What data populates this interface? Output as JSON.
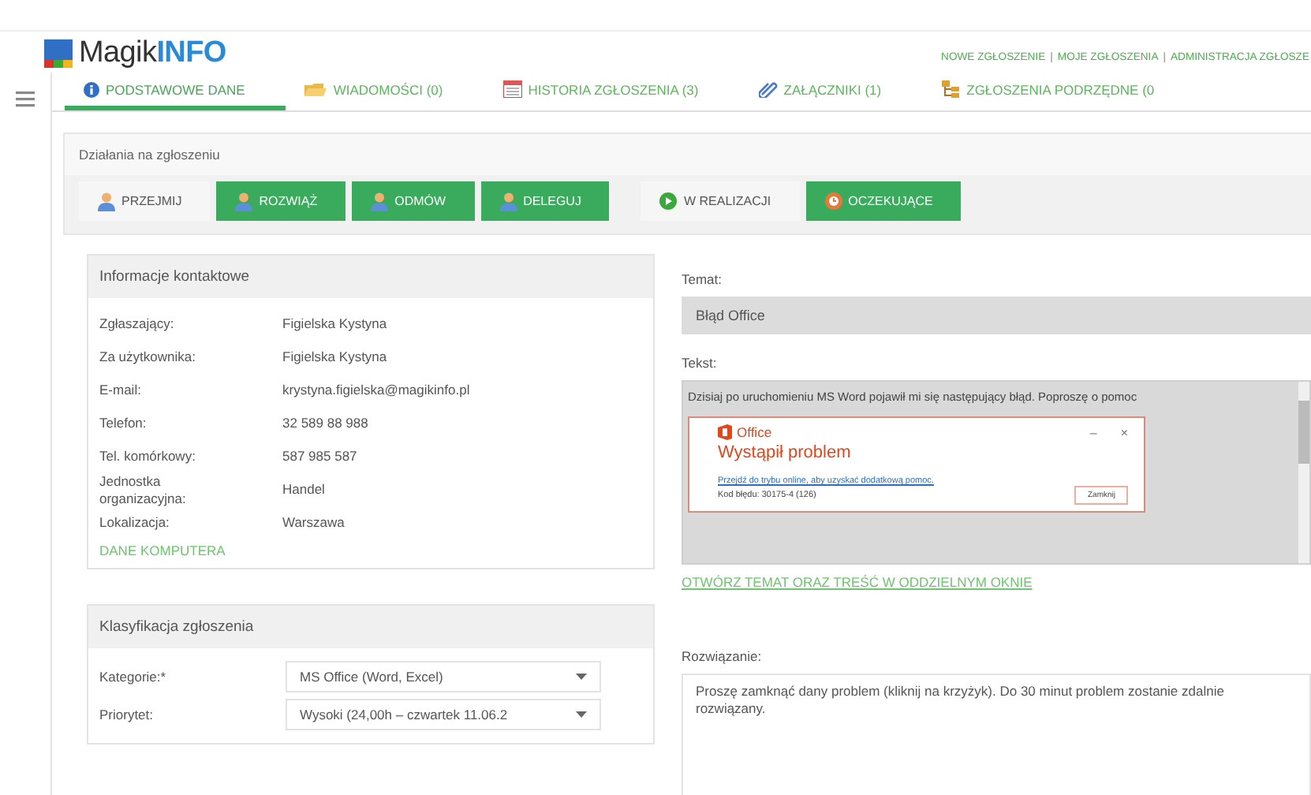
{
  "logo": {
    "brand": "Magik",
    "accent": "INFO"
  },
  "top_links": [
    "NOWE ZGŁOSZENIE",
    "MOJE ZGŁOSZENIA",
    "ADMINISTRACJA ZGŁOSZE"
  ],
  "link_separator": "|",
  "tabs": [
    {
      "label": "PODSTAWOWE DANE",
      "selected": true
    },
    {
      "label": "WIADOMOŚCI (0)",
      "selected": false
    },
    {
      "label": "HISTORIA ZGŁOSZENIA (3)",
      "selected": false
    },
    {
      "label": "ZAŁĄCZNIKI (1)",
      "selected": false
    },
    {
      "label": "ZGŁOSZENIA PODRZĘDNE (0",
      "selected": false
    }
  ],
  "actions": {
    "title": "Działania na zgłoszeniu",
    "ticket_buttons": [
      {
        "label": "PRZEJMIJ",
        "highlighted": false
      },
      {
        "label": "ROZWIĄŻ",
        "highlighted": true
      },
      {
        "label": "ODMÓW",
        "highlighted": true
      },
      {
        "label": "DELEGUJ",
        "highlighted": true
      }
    ],
    "status_buttons": [
      {
        "label": "W REALIZACJI",
        "highlighted": false
      },
      {
        "label": "OCZEKUJĄCE",
        "highlighted": true
      }
    ]
  },
  "contact": {
    "title": "Informacje kontaktowe",
    "fields": [
      {
        "label": "Zgłaszający:",
        "value": "Figielska Kystyna"
      },
      {
        "label": "Za użytkownika:",
        "value": "Figielska Kystyna"
      },
      {
        "label": "E-mail:",
        "value": "krystyna.figielska@magikinfo.pl"
      },
      {
        "label": "Telefon:",
        "value": "32 589 88 988"
      },
      {
        "label": "Tel. komórkowy:",
        "value": "587 985 587"
      },
      {
        "label": "Jednostka organizacyjna:",
        "value": "Handel"
      },
      {
        "label": "Lokalizacja:",
        "value": "Warszawa"
      }
    ],
    "link": "DANE KOMPUTERA"
  },
  "subject": {
    "label": "Temat:",
    "value": "Błąd Office"
  },
  "text": {
    "label": "Tekst:",
    "message": "Dzisiaj po uruchomieniu MS Word pojawił mi się następujący błąd. Poproszę o pomoc",
    "screenshot": {
      "app": "Office",
      "minimize": "–",
      "close": "×",
      "heading": "Wystąpił problem",
      "link": "Przejdź do trybu online, aby uzyskać dodatkową pomoc.",
      "code": "Kod błędu: 30175-4 (126)",
      "button": "Zamknij"
    },
    "open_link": "OTWÓRZ TEMAT ORAZ TREŚĆ W ODDZIELNYM OKNIE"
  },
  "classification": {
    "title": "Klasyfikacja zgłoszenia",
    "fields": [
      {
        "label": "Kategorie:*",
        "value": "MS Office (Word, Excel)"
      },
      {
        "label": "Priorytet:",
        "value": "Wysoki (24,00h – czwartek 11.06.2"
      }
    ]
  },
  "solution": {
    "label": "Rozwiązanie:",
    "value": "Proszę zamknąć dany problem (kliknij na krzyżyk). Do 30 minut problem zostanie zdalnie rozwiązany."
  }
}
